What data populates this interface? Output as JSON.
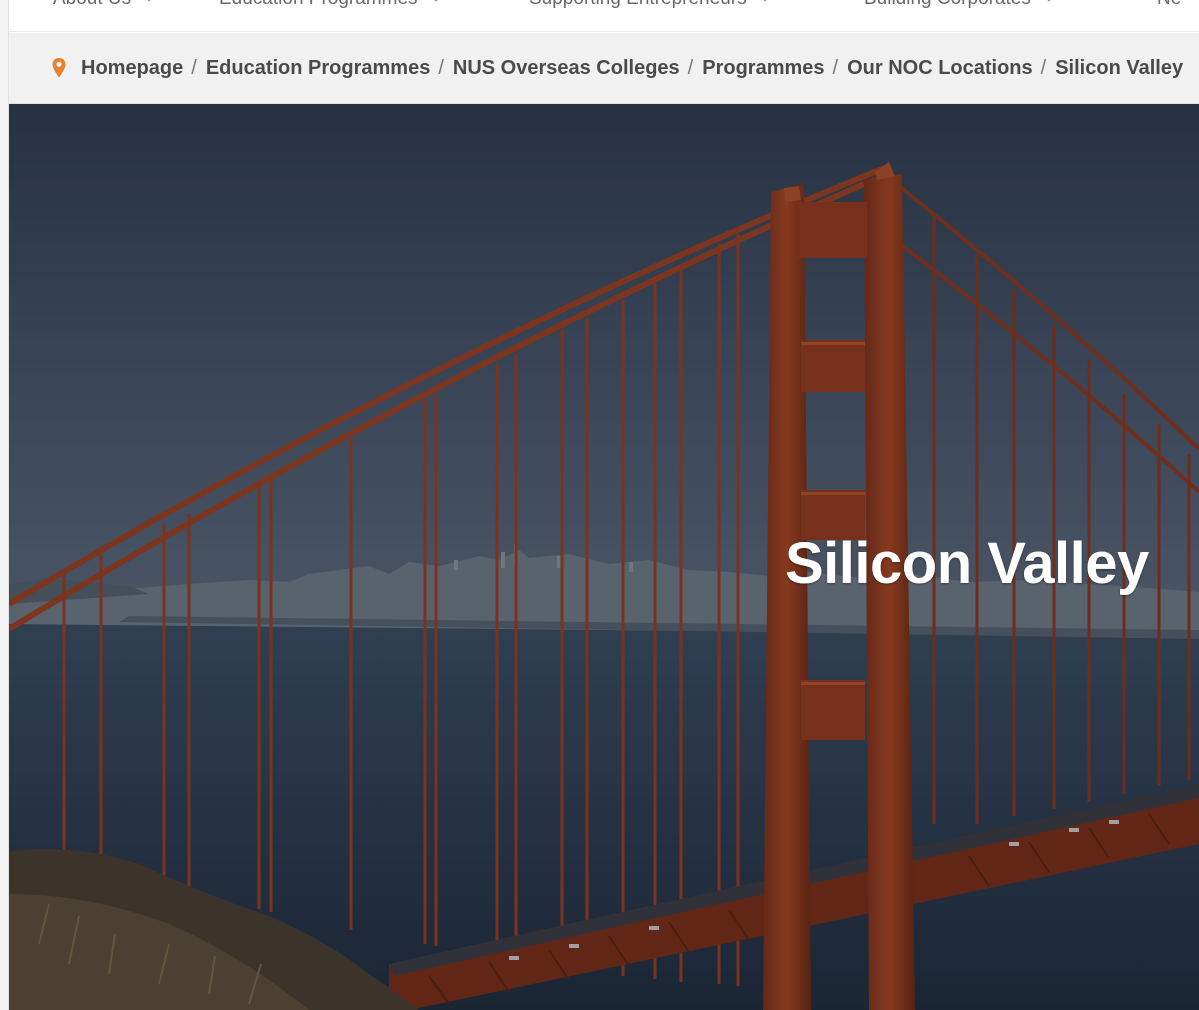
{
  "top_nav": {
    "items": [
      {
        "label": "About Us"
      },
      {
        "label": "Education Programmes"
      },
      {
        "label": "Supporting Entrepreneurs"
      },
      {
        "label": "Building Corporates"
      },
      {
        "label": "Ne"
      }
    ]
  },
  "breadcrumb": {
    "items": [
      {
        "label": "Homepage"
      },
      {
        "label": "Education Programmes"
      },
      {
        "label": "NUS Overseas Colleges"
      },
      {
        "label": "Programmes"
      },
      {
        "label": "Our NOC Locations"
      },
      {
        "label": "Silicon Valley"
      }
    ],
    "separator": "/"
  },
  "hero": {
    "title": "Silicon Valley",
    "image_subject": "golden-gate-bridge"
  },
  "colors": {
    "accent": "#e8822e",
    "breadcrumb_bg": "#f1f1f1",
    "bridge": "#a4401f",
    "hero_text": "#ffffff"
  }
}
